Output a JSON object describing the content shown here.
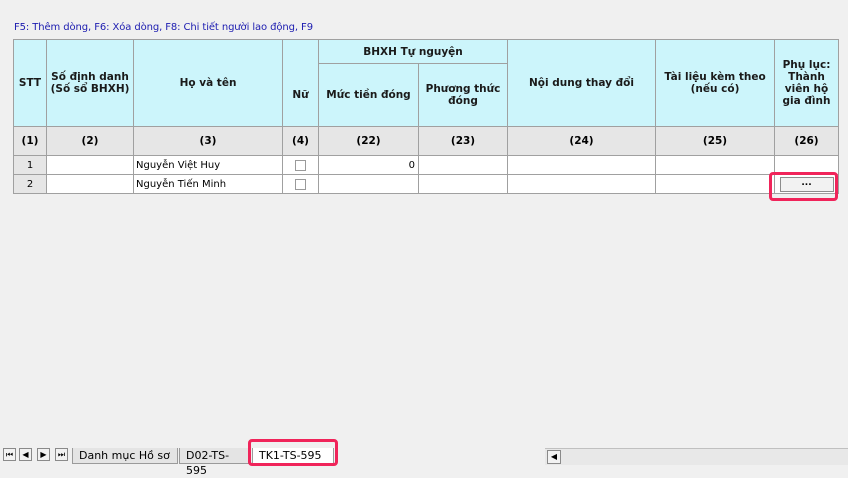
{
  "hint_bar": {
    "text": "F5: Thêm dòng, F6: Xóa dòng, F8: Chi tiết người lao động, F9"
  },
  "table": {
    "headers": {
      "stt": "STT",
      "so_dinh_danh": "Số định danh (Số sổ BHXH)",
      "ho_va_ten": "Họ và tên",
      "nu": "Nữ",
      "bhxh_tu_nguyen": "BHXH Tự nguyện",
      "muc_tien_dong": "Mức tiền đóng",
      "phuong_thuc_dong": "Phương thức đóng",
      "noi_dung_thay_doi": "Nội dung thay đổi",
      "tai_lieu_kem_theo": "Tài liệu kèm theo (nếu có)",
      "phu_luc": "Phụ lục: Thành viên hộ gia đình"
    },
    "column_numbers": [
      "(1)",
      "(2)",
      "(3)",
      "(4)",
      "(22)",
      "(23)",
      "(24)",
      "(25)",
      "(26)"
    ],
    "rows": [
      {
        "stt": "1",
        "so_dinh_danh": "",
        "ho_va_ten": "Nguyễn Việt Huy",
        "nu": false,
        "muc_tien_dong": "0",
        "phuong_thuc_dong": "",
        "noi_dung_thay_doi": "",
        "tai_lieu_kem_theo": "",
        "phu_luc": ""
      },
      {
        "stt": "2",
        "so_dinh_danh": "",
        "ho_va_ten": "Nguyễn Tiến Minh",
        "nu": false,
        "muc_tien_dong": "",
        "phuong_thuc_dong": "",
        "noi_dung_thay_doi": "",
        "tai_lieu_kem_theo": "",
        "phu_luc_button": "..."
      }
    ]
  },
  "sheet_tabs": {
    "nav_first": "⏮",
    "nav_prev": "◀",
    "nav_next": "▶",
    "nav_last": "⏭",
    "tabs": [
      "Danh mục Hồ sơ",
      "D02-TS-595",
      "TK1-TS-595"
    ],
    "active_tab": "TK1-TS-595"
  },
  "colors": {
    "header_bg": "#ccf5fb",
    "number_row_bg": "#e6e6e6",
    "hint_text": "#1c1cb0",
    "highlight": "#f0245a"
  }
}
